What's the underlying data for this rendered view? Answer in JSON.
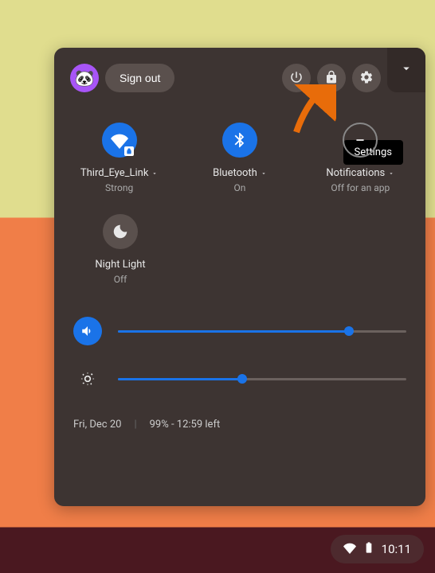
{
  "header": {
    "sign_out_label": "Sign out",
    "tooltip_settings": "Settings"
  },
  "tiles": {
    "wifi": {
      "label": "Third_Eye_Link",
      "status": "Strong"
    },
    "bluetooth": {
      "label": "Bluetooth",
      "status": "On"
    },
    "notifications": {
      "label": "Notifications",
      "status": "Off for an app"
    },
    "night_light": {
      "label": "Night Light",
      "status": "Off"
    }
  },
  "sliders": {
    "volume_percent": 80,
    "brightness_percent": 43
  },
  "footer": {
    "date": "Fri, Dec 20",
    "battery": "99% - 12:59 left"
  },
  "shelf": {
    "time": "10:11"
  },
  "colors": {
    "accent": "#1a73e8",
    "panel_bg": "#3d3432"
  }
}
